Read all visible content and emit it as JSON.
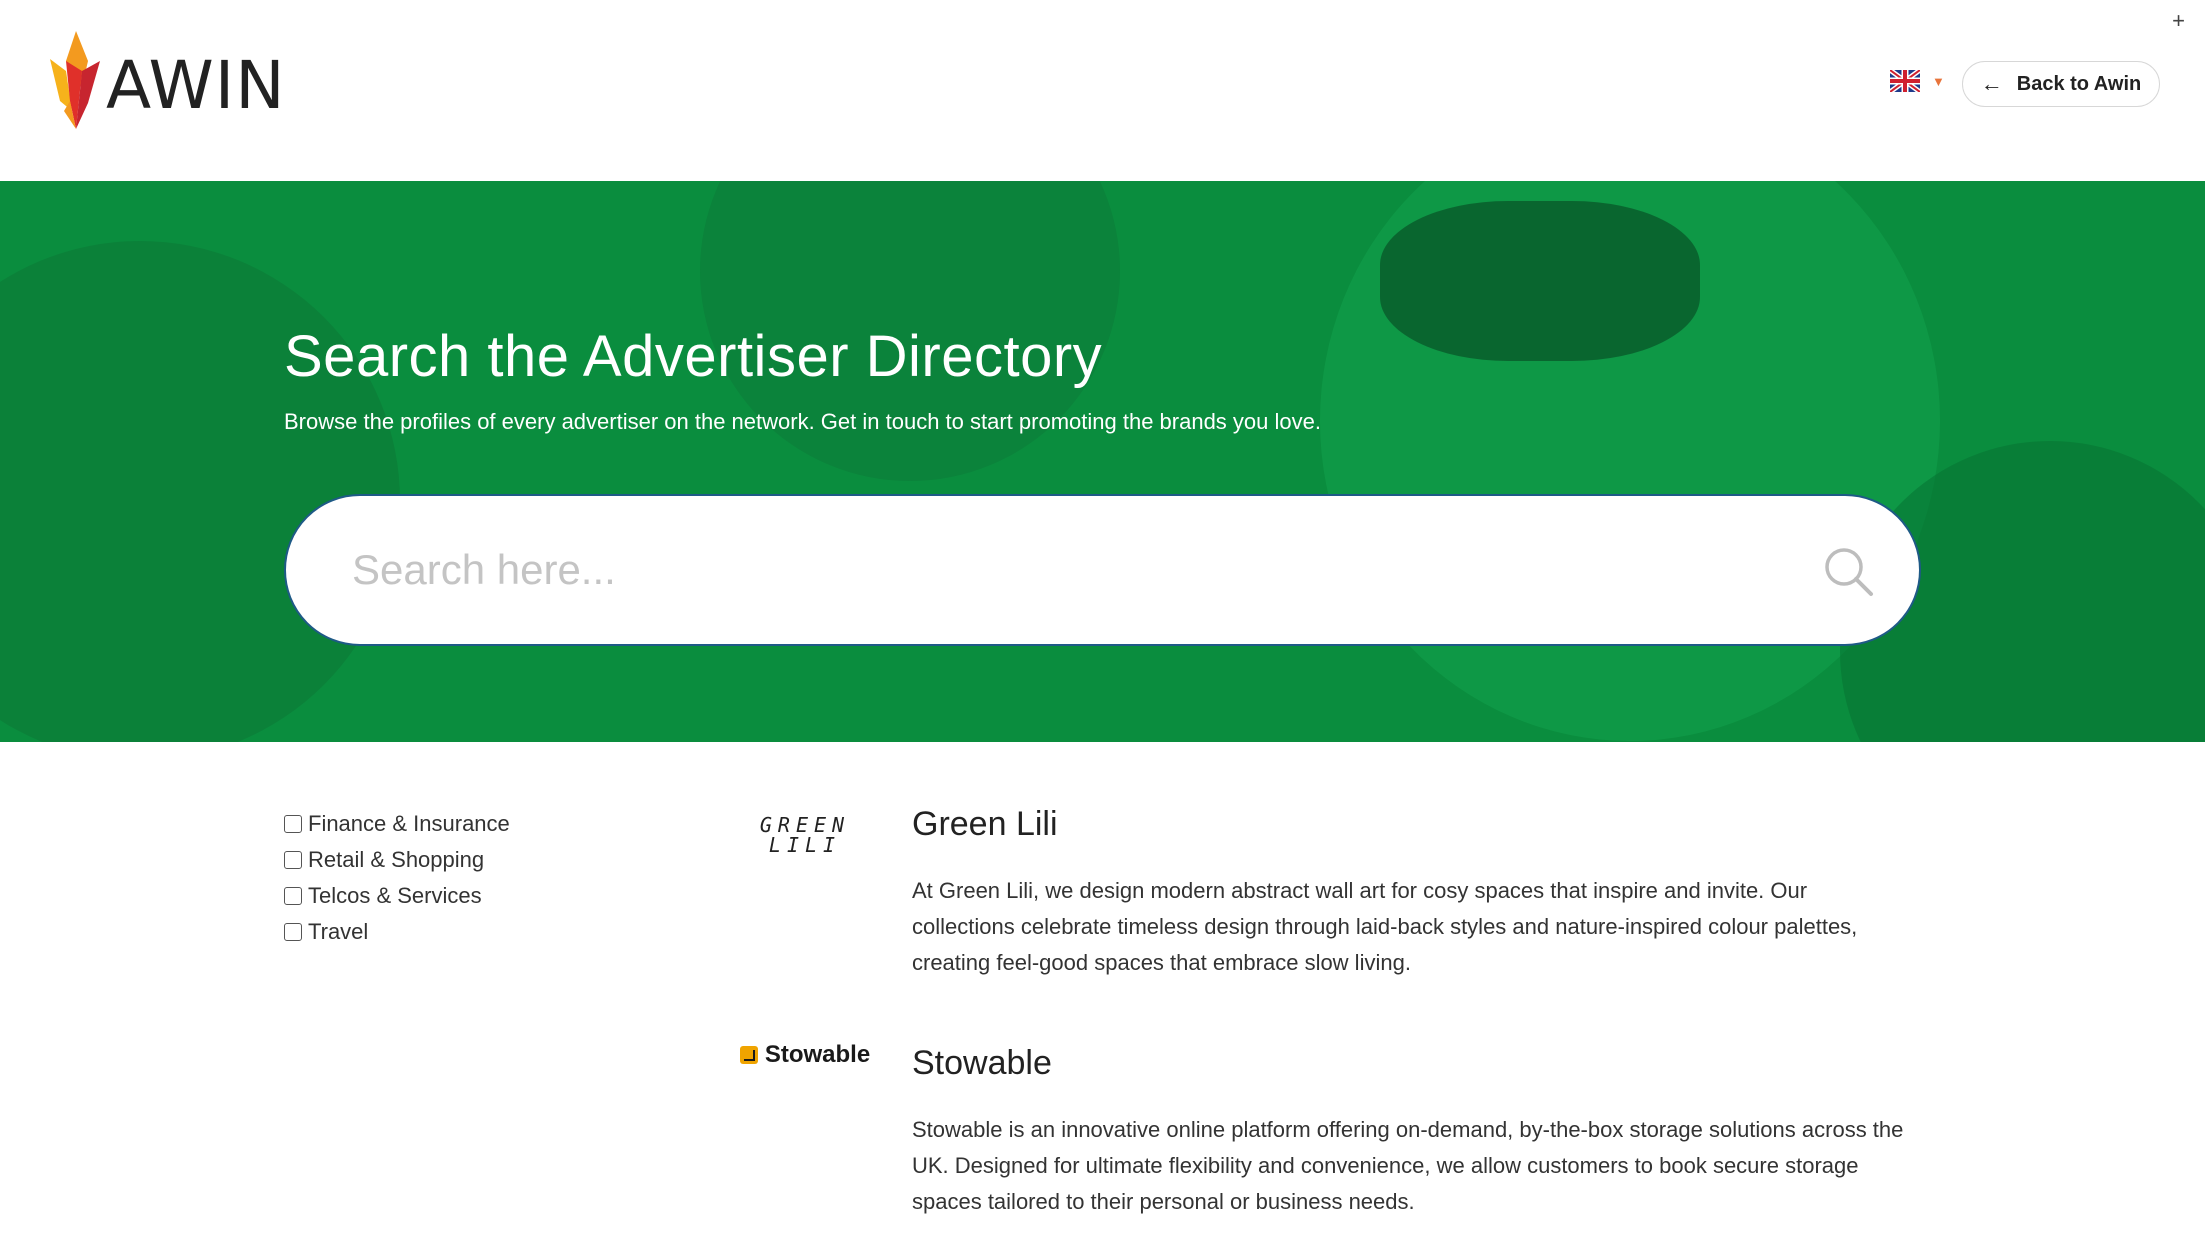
{
  "header": {
    "logo_text": "AWIN",
    "back_label": "Back to Awin",
    "corner_glyph": "+",
    "language_icon": "uk-flag-icon"
  },
  "hero": {
    "title": "Search the Advertiser Directory",
    "subtitle": "Browse the profiles of every advertiser on the network. Get in touch to start promoting the brands you love.",
    "search_placeholder": "Search here...",
    "search_value": "",
    "background_color": "#0a8d3e"
  },
  "filters": [
    {
      "label": "Finance & Insurance",
      "checked": false
    },
    {
      "label": "Retail & Shopping",
      "checked": false
    },
    {
      "label": "Telcos & Services",
      "checked": false
    },
    {
      "label": "Travel",
      "checked": false
    }
  ],
  "advertisers": [
    {
      "name": "Green Lili",
      "logo_text_line1": "GREEN",
      "logo_text_line2": "LILI",
      "description": "At Green Lili, we design modern abstract wall art for cosy spaces that inspire and invite. Our collections celebrate timeless design through laid-back styles and nature-inspired colour palettes, creating feel-good spaces that embrace slow living."
    },
    {
      "name": "Stowable",
      "logo_text": "Stowable",
      "description": "Stowable is an innovative online platform offering on-demand, by-the-box storage solutions across the UK. Designed for ultimate flexibility and convenience, we allow customers to book secure storage spaces tailored to their personal or business needs."
    }
  ],
  "colors": {
    "brand_orange": "#e8743b",
    "brand_red": "#e0302a",
    "hero_green": "#0a8d3e",
    "search_border": "#1e5a86"
  }
}
